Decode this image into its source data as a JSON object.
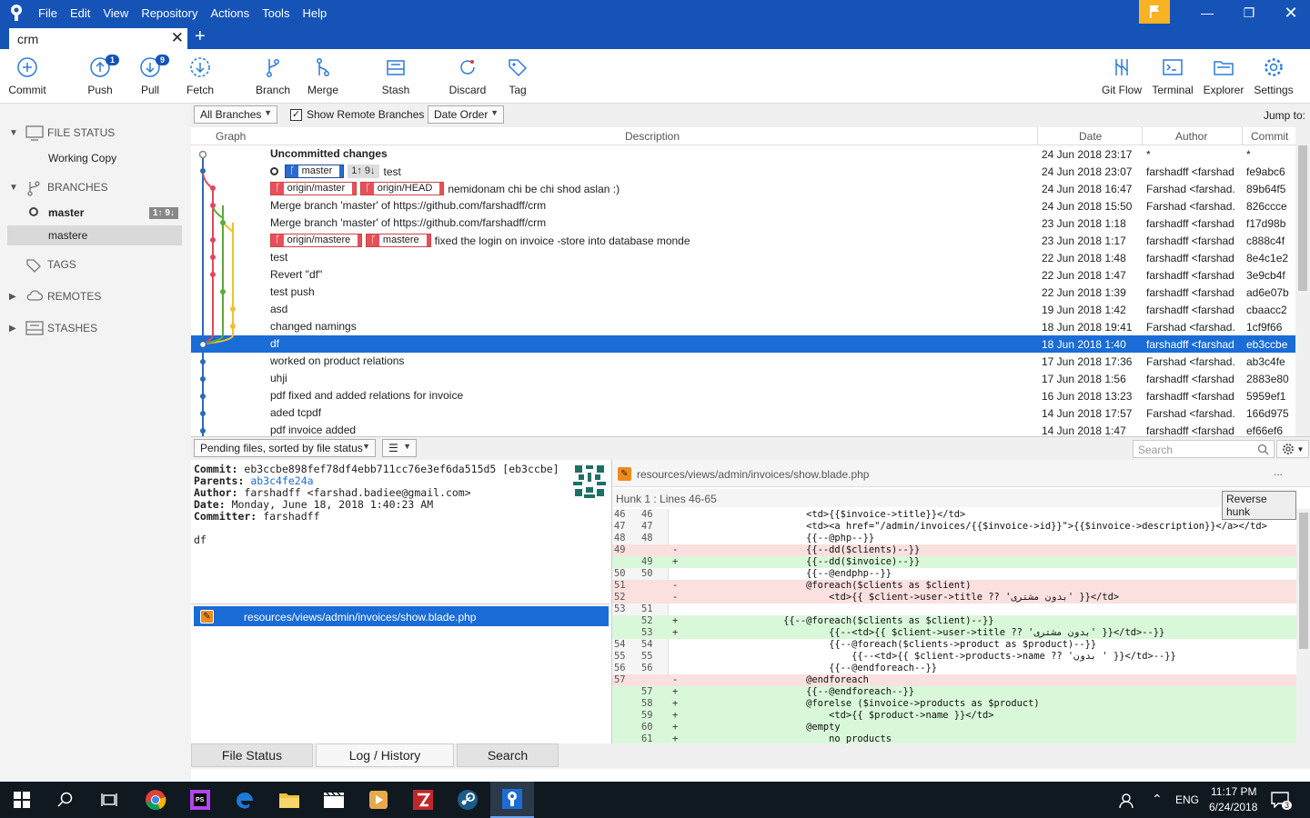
{
  "menu": [
    "File",
    "Edit",
    "View",
    "Repository",
    "Actions",
    "Tools",
    "Help"
  ],
  "tab": {
    "title": "crm"
  },
  "toolbar": {
    "commit": "Commit",
    "push": "Push",
    "push_badge": "1",
    "pull": "Pull",
    "pull_badge": "9",
    "fetch": "Fetch",
    "branch": "Branch",
    "merge": "Merge",
    "stash": "Stash",
    "discard": "Discard",
    "tag": "Tag",
    "gitflow": "Git Flow",
    "terminal": "Terminal",
    "explorer": "Explorer",
    "settings": "Settings"
  },
  "sidebar": {
    "file_status": "FILE STATUS",
    "working_copy": "Working Copy",
    "branches": "BRANCHES",
    "master": "master",
    "master_badge": "1↑ 9↓",
    "mastere": "mastere",
    "tags": "TAGS",
    "remotes": "REMOTES",
    "stashes": "STASHES"
  },
  "filter": {
    "branches": "All Branches",
    "show_remote": "Show Remote Branches",
    "order": "Date Order",
    "jump": "Jump to:"
  },
  "columns": {
    "graph": "Graph",
    "description": "Description",
    "date": "Date",
    "author": "Author",
    "commit": "Commit"
  },
  "commits": [
    {
      "desc": "Uncommitted changes",
      "date": "24 Jun 2018 23:17",
      "author": "*",
      "hash": "*",
      "bold": true
    },
    {
      "refs": [
        {
          "name": "master",
          "style": "head"
        }
      ],
      "count": "1↑ 9↓",
      "desc": "test",
      "date": "24 Jun 2018 23:07",
      "author": "farshadff <farshad",
      "hash": "fe9abc6"
    },
    {
      "refs": [
        {
          "name": "origin/master",
          "style": "remote"
        },
        {
          "name": "origin/HEAD",
          "style": "remote"
        }
      ],
      "desc": "nemidonam chi be chi shod aslan :)",
      "date": "24 Jun 2018 16:47",
      "author": "Farshad <farshad.b",
      "hash": "89b64f5"
    },
    {
      "desc": "Merge branch 'master' of https://github.com/farshadff/crm",
      "date": "24 Jun 2018 15:50",
      "author": "Farshad <farshad.b",
      "hash": "826ccce"
    },
    {
      "desc": "Merge branch 'master' of https://github.com/farshadff/crm",
      "date": "23 Jun 2018 1:18",
      "author": "farshadff <farshad",
      "hash": "f17d98b"
    },
    {
      "refs": [
        {
          "name": "origin/mastere",
          "style": "remote"
        },
        {
          "name": "mastere",
          "style": "remote"
        }
      ],
      "desc": "fixed the login on invoice -store into database monde",
      "date": "23 Jun 2018 1:17",
      "author": "farshadff <farshad",
      "hash": "c888c4f"
    },
    {
      "desc": "test",
      "date": "22 Jun 2018 1:48",
      "author": "farshadff <farshad",
      "hash": "8e4c1e2"
    },
    {
      "desc": "Revert \"df\"",
      "date": "22 Jun 2018 1:47",
      "author": "farshadff <farshad",
      "hash": "3e9cb4f"
    },
    {
      "desc": "test push",
      "date": "22 Jun 2018 1:39",
      "author": "farshadff <farshad",
      "hash": "ad6e07b"
    },
    {
      "desc": "asd",
      "date": "19 Jun 2018 1:42",
      "author": "farshadff <farshad",
      "hash": "cbaacc2"
    },
    {
      "desc": "changed namings",
      "date": "18 Jun 2018 19:41",
      "author": "Farshad <farshad.b",
      "hash": "1cf9f66"
    },
    {
      "desc": "df",
      "date": "18 Jun 2018 1:40",
      "author": "farshadff <farshad",
      "hash": "eb3ccbe",
      "selected": true
    },
    {
      "desc": "worked on product relations",
      "date": "17 Jun 2018 17:36",
      "author": "Farshad <farshad.b",
      "hash": "ab3c4fe"
    },
    {
      "desc": "uhji",
      "date": "17 Jun 2018 1:56",
      "author": "farshadff <farshad",
      "hash": "2883e80"
    },
    {
      "desc": "pdf fixed and added relations for invoice",
      "date": "16 Jun 2018 13:23",
      "author": "farshadff <farshad",
      "hash": "5959ef1"
    },
    {
      "desc": "aded tcpdf",
      "date": "14 Jun 2018 17:57",
      "author": "Farshad <farshad.b",
      "hash": "166d975"
    },
    {
      "desc": "pdf invoice added",
      "date": "14 Jun 2018 1:47",
      "author": "farshadff <farshad",
      "hash": "ef66ef6"
    }
  ],
  "pending": {
    "sort": "Pending files, sorted by file status",
    "search_placeholder": "Search"
  },
  "details": {
    "commit_label": "Commit:",
    "commit": "eb3ccbe898fef78df4ebb711cc76e3ef6da515d5 [eb3ccbe]",
    "parents_label": "Parents:",
    "parents": "ab3c4fe24a",
    "author_label": "Author:",
    "author": "farshadff <farshad.badiee@gmail.com>",
    "date_label": "Date:",
    "date": "Monday, June 18, 2018 1:40:23 AM",
    "committer_label": "Committer:",
    "committer": "farshadff",
    "message": "df"
  },
  "file": {
    "path": "resources/views/admin/invoices/show.blade.php"
  },
  "diff": {
    "path": "resources/views/admin/invoices/show.blade.php",
    "more": "...",
    "hunk": "Hunk 1 : Lines 46-65",
    "reverse": "Reverse hunk",
    "lines": [
      {
        "a": "46",
        "b": "46",
        "s": "",
        "t": "                    <td>{{$invoice->title}}</td>",
        "k": "ctx"
      },
      {
        "a": "47",
        "b": "47",
        "s": "",
        "t": "                    <td><a href=\"/admin/invoices/{{$invoice->id}}\">{{$invoice->description}}</a></td>",
        "k": "ctx"
      },
      {
        "a": "48",
        "b": "48",
        "s": "",
        "t": "                    {{--@php--}}",
        "k": "ctx"
      },
      {
        "a": "49",
        "b": "",
        "s": "-",
        "t": "                    {{--dd($clients)--}}",
        "k": "del"
      },
      {
        "a": "",
        "b": "49",
        "s": "+",
        "t": "                    {{--dd($invoice)--}}",
        "k": "add"
      },
      {
        "a": "50",
        "b": "50",
        "s": "",
        "t": "                    {{--@endphp--}}",
        "k": "ctx"
      },
      {
        "a": "51",
        "b": "",
        "s": "-",
        "t": "                    @foreach($clients as $client)",
        "k": "del"
      },
      {
        "a": "52",
        "b": "",
        "s": "-",
        "t": "                        <td>{{ $client->user->title ?? 'بدون مشتری' }}</td>",
        "k": "del"
      },
      {
        "a": "53",
        "b": "51",
        "s": "",
        "t": "",
        "k": "ctx"
      },
      {
        "a": "",
        "b": "52",
        "s": "+",
        "t": "                {{--@foreach($clients as $client)--}}",
        "k": "add"
      },
      {
        "a": "",
        "b": "53",
        "s": "+",
        "t": "                        {{--<td>{{ $client->user->title ?? 'بدون مشتری' }}</td>--}}",
        "k": "add"
      },
      {
        "a": "54",
        "b": "54",
        "s": "",
        "t": "                        {{--@foreach($clients->product as $product)--}}",
        "k": "ctx"
      },
      {
        "a": "55",
        "b": "55",
        "s": "",
        "t": "                            {{--<td>{{ $client->products->name ?? 'بدون ' }}</td>--}}",
        "k": "ctx"
      },
      {
        "a": "56",
        "b": "56",
        "s": "",
        "t": "                        {{--@endforeach--}}",
        "k": "ctx"
      },
      {
        "a": "57",
        "b": "",
        "s": "-",
        "t": "                    @endforeach",
        "k": "del"
      },
      {
        "a": "",
        "b": "57",
        "s": "+",
        "t": "                    {{--@endforeach--}}",
        "k": "add"
      },
      {
        "a": "",
        "b": "58",
        "s": "+",
        "t": "                    @forelse ($invoice->products as $product)",
        "k": "add"
      },
      {
        "a": "",
        "b": "59",
        "s": "+",
        "t": "                        <td>{{ $product->name }}</td>",
        "k": "add"
      },
      {
        "a": "",
        "b": "60",
        "s": "+",
        "t": "                    @empty",
        "k": "add"
      },
      {
        "a": "",
        "b": "61",
        "s": "+",
        "t": "                        no products",
        "k": "add"
      }
    ]
  },
  "bottom_tabs": {
    "file_status": "File Status",
    "log": "Log / History",
    "search": "Search"
  },
  "tray": {
    "lang": "ENG",
    "time": "11:17 PM",
    "date": "6/24/2018",
    "notif": "3"
  },
  "colors": {
    "accent": "#1553b7",
    "selection": "#1a6cd6",
    "flag": "#f9b222"
  }
}
